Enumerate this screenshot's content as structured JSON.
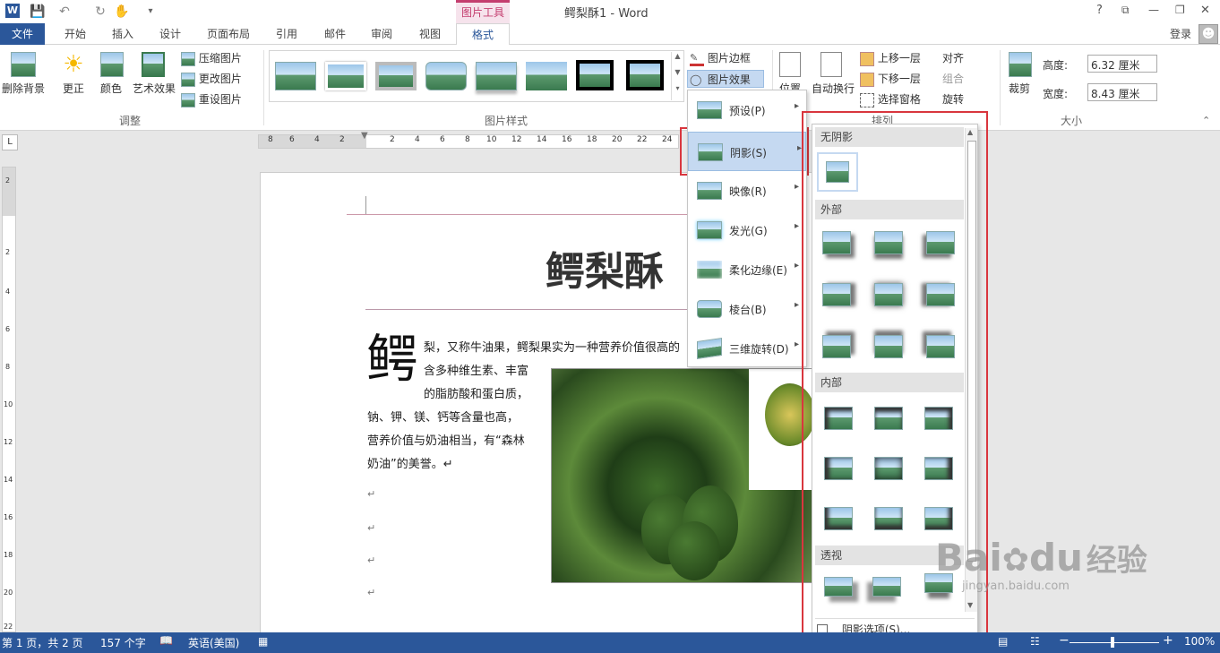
{
  "window": {
    "title": "鳄梨酥1 - Word",
    "contextual_tab_group": "图片工具",
    "controls": [
      "?",
      "⧉",
      "—",
      "❐",
      "✕"
    ],
    "user": "登录"
  },
  "tabs": [
    {
      "label": "文件"
    },
    {
      "label": "开始"
    },
    {
      "label": "插入"
    },
    {
      "label": "设计"
    },
    {
      "label": "页面布局"
    },
    {
      "label": "引用"
    },
    {
      "label": "邮件"
    },
    {
      "label": "审阅"
    },
    {
      "label": "视图"
    },
    {
      "label": "格式"
    }
  ],
  "ribbon": {
    "remove_bg": "删除背景",
    "corrections": "更正",
    "color": "颜色",
    "artistic": "艺术效果",
    "compress": "压缩图片",
    "change": "更改图片",
    "reset": "重设图片",
    "group_adjust": "调整",
    "group_styles": "图片样式",
    "pic_border": "图片边框",
    "pic_effects": "图片效果",
    "position": "位置",
    "wrap": "自动换行",
    "bring_forward": "上移一层",
    "send_backward": "下移一层",
    "selection_pane": "选择窗格",
    "align": "对齐",
    "group": "组合",
    "rotate": "旋转",
    "group_arrange": "排列",
    "crop": "裁剪",
    "height_label": "高度:",
    "height_value": "6.32 厘米",
    "width_label": "宽度:",
    "width_value": "8.43 厘米",
    "group_size": "大小"
  },
  "ruler": {
    "ticks": [
      "8",
      "6",
      "4",
      "2",
      "2",
      "4",
      "6",
      "8",
      "10",
      "12",
      "14",
      "16",
      "18",
      "20",
      "22",
      "24"
    ],
    "vticks": [
      "2",
      "2",
      "4",
      "6",
      "8",
      "10",
      "12",
      "14",
      "16",
      "18",
      "20",
      "22"
    ]
  },
  "effects_menu": [
    {
      "label": "预设(P)"
    },
    {
      "label": "阴影(S)"
    },
    {
      "label": "映像(R)"
    },
    {
      "label": "发光(G)"
    },
    {
      "label": "柔化边缘(E)"
    },
    {
      "label": "棱台(B)"
    },
    {
      "label": "三维旋转(D)"
    }
  ],
  "shadow_gallery": {
    "no_shadow": "无阴影",
    "outer": "外部",
    "inner": "内部",
    "perspective": "透视",
    "options": "阴影选项(S)..."
  },
  "document": {
    "title": "鳄梨酥",
    "dropcap": "鳄",
    "lines": [
      "梨，又称牛油果，鳄梨果实为一种营养价值很高的",
      "含多种维生素、丰富",
      "的脂肪酸和蛋白质，",
      "钠、钾、镁、钙等含量也高，",
      "营养价值与奶油相当，有“森林",
      "奶油”的美誉。↵"
    ],
    "para_mark": "↵"
  },
  "status": {
    "page": "第 1 页，共 2 页",
    "words": "157 个字",
    "lang": "英语(美国)",
    "zoom": "100%"
  },
  "watermark": {
    "brand": "Bai",
    "brand2": "du",
    "cn": "经验",
    "url": "jingyan.baidu.com"
  },
  "colors": {
    "accent": "#2b579a",
    "contextual": "#c43e6f",
    "highlight": "#d9363e"
  }
}
